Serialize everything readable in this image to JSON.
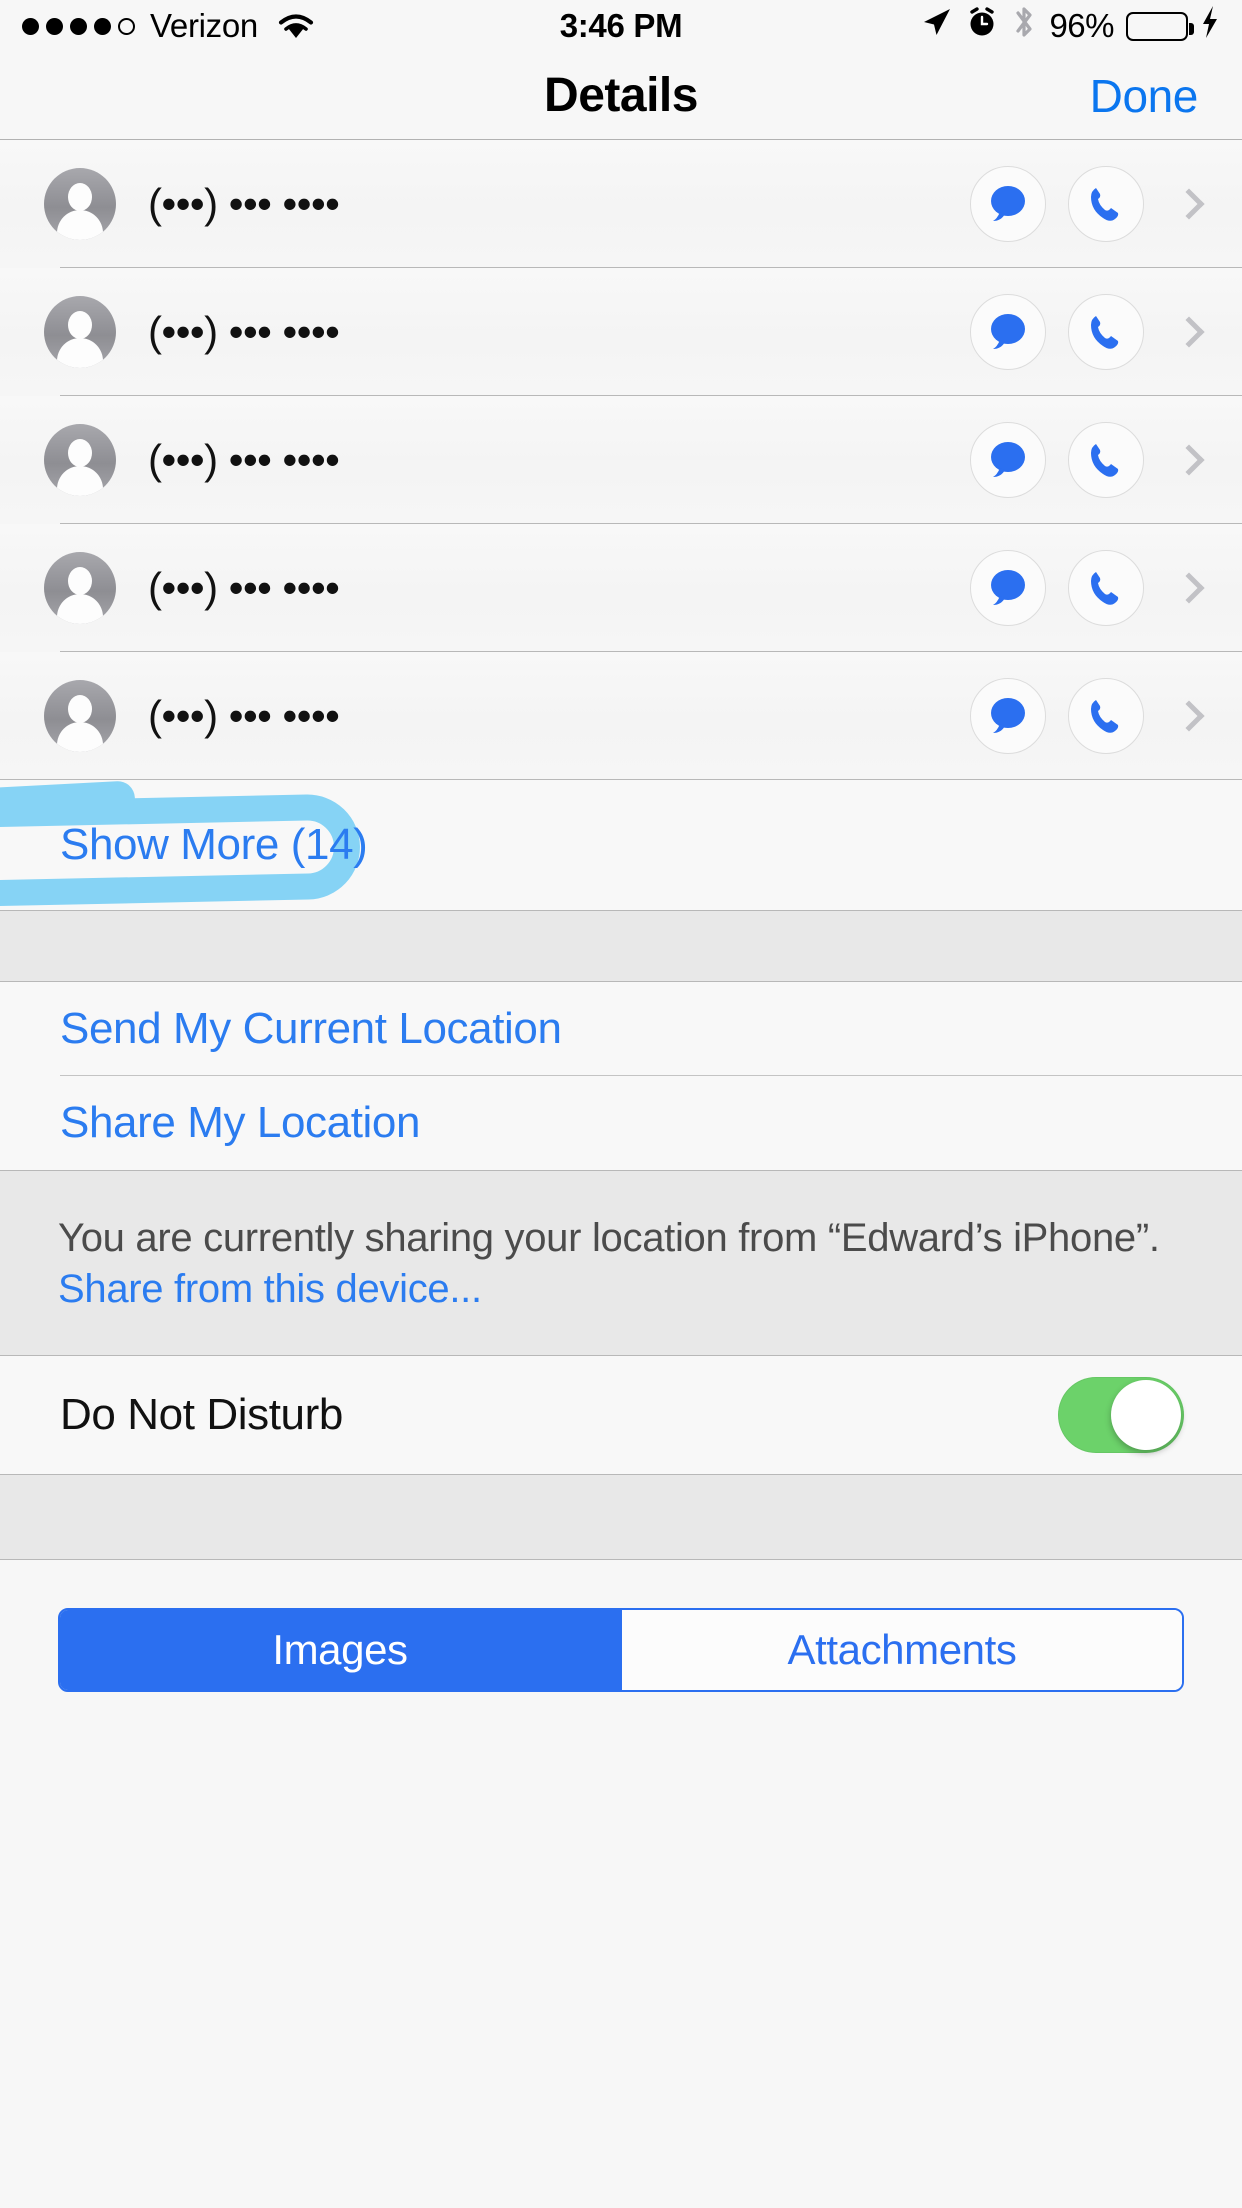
{
  "status_bar": {
    "carrier": "Verizon",
    "signal_dots_filled": 4,
    "signal_dots_total": 5,
    "wifi_icon": "wifi-icon",
    "time": "3:46 PM",
    "location_icon": "location-arrow-icon",
    "alarm_icon": "alarm-clock-icon",
    "bluetooth_icon": "bluetooth-icon",
    "battery_percent": "96%",
    "battery_charging": true,
    "battery_color": "#76d275"
  },
  "nav": {
    "title": "Details",
    "done_label": "Done"
  },
  "contacts": [
    {
      "number": "(•••) ••• ••••",
      "redacted": true,
      "message_icon": "message-bubble-icon",
      "call_icon": "phone-icon",
      "chevron_icon": "chevron-right-icon"
    },
    {
      "number": "(•••) ••• ••••",
      "redacted": true,
      "message_icon": "message-bubble-icon",
      "call_icon": "phone-icon",
      "chevron_icon": "chevron-right-icon"
    },
    {
      "number": "(•••) ••• ••••",
      "redacted": true,
      "message_icon": "message-bubble-icon",
      "call_icon": "phone-icon",
      "chevron_icon": "chevron-right-icon"
    },
    {
      "number": "(•••) ••• ••••",
      "redacted": true,
      "message_icon": "message-bubble-icon",
      "call_icon": "phone-icon",
      "chevron_icon": "chevron-right-icon"
    },
    {
      "number": "(•••) ••• ••••",
      "redacted": true,
      "message_icon": "message-bubble-icon",
      "call_icon": "phone-icon",
      "chevron_icon": "chevron-right-icon"
    }
  ],
  "show_more": {
    "label": "Show More (14)",
    "annotation": "blue-highlighter-circle"
  },
  "location": {
    "send_current_label": "Send My Current Location",
    "share_label": "Share My Location",
    "note_text": "You are currently sharing your location from “Edward’s iPhone”.",
    "note_link": "Share from this device..."
  },
  "do_not_disturb": {
    "label": "Do Not Disturb",
    "enabled": true,
    "on_color": "#6cd26a"
  },
  "segmented": {
    "options": [
      {
        "label": "Images",
        "selected": true
      },
      {
        "label": "Attachments",
        "selected": false
      }
    ],
    "accent_color": "#2b6ff0"
  },
  "colors": {
    "tint_blue": "#2b7cf0",
    "nav_blue": "#0b76ef",
    "redaction_blue": "#86d3f5",
    "background": "#f7f7f7",
    "group_gap": "#e8e8e8"
  }
}
